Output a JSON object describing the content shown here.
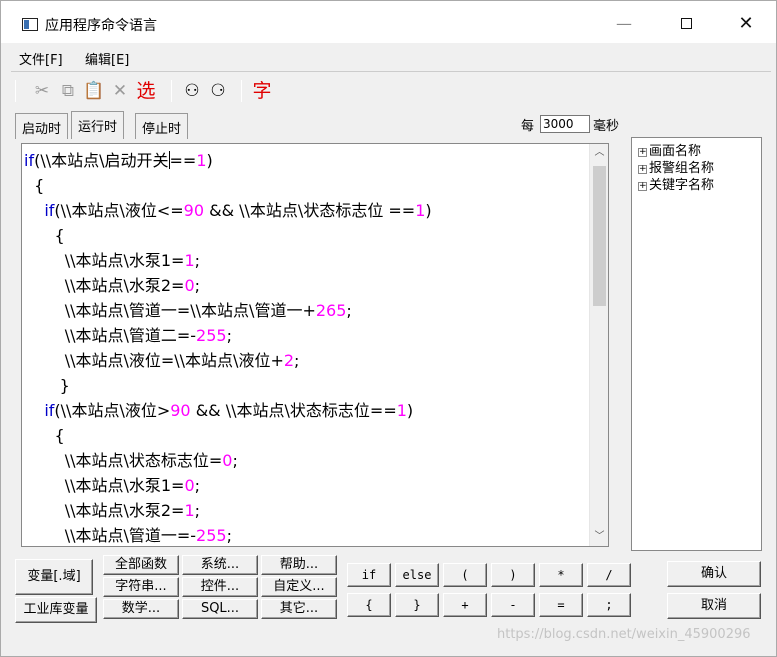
{
  "window": {
    "title": "应用程序命令语言"
  },
  "menu": {
    "items": [
      "文件[F]",
      "编辑[E]"
    ]
  },
  "toolbar": {
    "cut_icon": "scissors-icon",
    "copy_icon": "copy-icon",
    "paste_icon": "paste-icon",
    "delete_icon": "delete-x-icon",
    "select_label": "选",
    "find_icon": "binoculars-icon",
    "replace_icon": "binoculars-replace-icon",
    "font_label": "字"
  },
  "tabs": [
    "启动时",
    "运行时",
    "停止时"
  ],
  "interval": {
    "prefix": "每",
    "value": "3000",
    "unit": "毫秒"
  },
  "code": {
    "lines": [
      "if(\\\\本站点\\启动开关==1)",
      "  {",
      "    if(\\\\本站点\\液位<=90 && \\\\本站点\\状态标志位 ==1)",
      "      {",
      "        \\\\本站点\\水泵1=1;",
      "        \\\\本站点\\水泵2=0;",
      "        \\\\本站点\\管道一=\\\\本站点\\管道一+265;",
      "        \\\\本站点\\管道二=-255;",
      "        \\\\本站点\\液位=\\\\本站点\\液位+2;",
      "       }",
      "    if(\\\\本站点\\液位>90 && \\\\本站点\\状态标志位==1)",
      "      {",
      "        \\\\本站点\\状态标志位=0;",
      "        \\\\本站点\\水泵1=0;",
      "        \\\\本站点\\水泵2=1;",
      "        \\\\本站点\\管道一=-255;"
    ]
  },
  "tree": {
    "items": [
      "画面名称",
      "报警组名称",
      "关键字名称"
    ]
  },
  "buttons": {
    "var_field": "变量[.域]",
    "lib_var": "工业库变量",
    "functions": [
      "全部函数",
      "系统...",
      "帮助...",
      "字符串...",
      "控件...",
      "自定义...",
      "数学...",
      "SQL...",
      "其它..."
    ],
    "operators_row1": [
      "if",
      "else",
      "(",
      ")",
      "*",
      "/"
    ],
    "operators_row2": [
      "{",
      "}",
      "+",
      "-",
      "=",
      ";"
    ],
    "confirm": "确认",
    "cancel": "取消"
  },
  "watermark": "https://blog.csdn.net/weixin_45900296"
}
